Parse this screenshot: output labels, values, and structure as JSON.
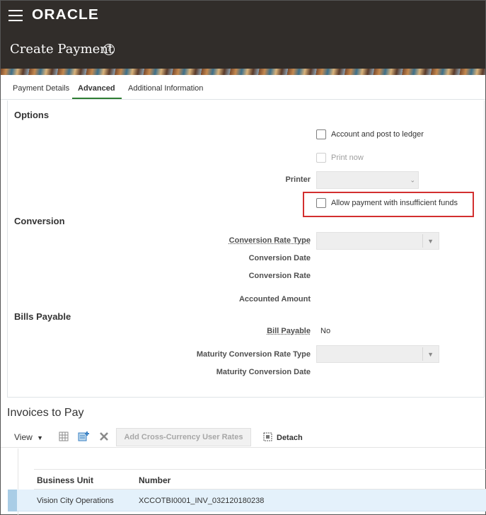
{
  "header": {
    "brand": "ORACLE",
    "page_title": "Create Payment",
    "help_glyph": "?"
  },
  "tabs": [
    {
      "label": "Payment Details",
      "active": false
    },
    {
      "label": "Advanced",
      "active": true
    },
    {
      "label": "Additional Information",
      "active": false
    }
  ],
  "options": {
    "title": "Options",
    "account_post_label": "Account and post to ledger",
    "account_post_checked": false,
    "print_now_label": "Print now",
    "print_now_checked": false,
    "printer_label": "Printer",
    "printer_value": "",
    "allow_insufficient_label": "Allow payment with insufficient funds",
    "allow_insufficient_checked": false
  },
  "conversion": {
    "title": "Conversion",
    "rate_type_label": "Conversion Rate Type",
    "rate_type_value": "",
    "date_label": "Conversion Date",
    "rate_label": "Conversion Rate",
    "accounted_amount_label": "Accounted Amount"
  },
  "bills_payable": {
    "title": "Bills Payable",
    "bill_payable_label": "Bill Payable",
    "bill_payable_value": "No",
    "maturity_rate_type_label": "Maturity Conversion Rate Type",
    "maturity_rate_type_value": "",
    "maturity_date_label": "Maturity Conversion Date"
  },
  "invoices": {
    "title": "Invoices to Pay",
    "toolbar": {
      "view_label": "View",
      "add_rates_label": "Add Cross-Currency User Rates",
      "detach_label": "Detach"
    },
    "columns": [
      "Business Unit",
      "Number"
    ],
    "rows": [
      {
        "business_unit": "Vision City Operations",
        "number": "XCCOTBI0001_INV_032120180238",
        "selected": true
      }
    ]
  },
  "icons": {
    "menu": "hamburger-icon",
    "help": "help-circle-icon",
    "dropdown": "chevron-down-icon",
    "freeze": "freeze-columns-icon",
    "add_row": "add-row-icon",
    "delete": "close-icon",
    "detach": "detach-icon"
  },
  "colors": {
    "header_bg": "#312d2a",
    "active_tab_underline": "#2e7d32",
    "highlight_box": "#d32f2f",
    "selected_row": "#e4f1fb"
  }
}
